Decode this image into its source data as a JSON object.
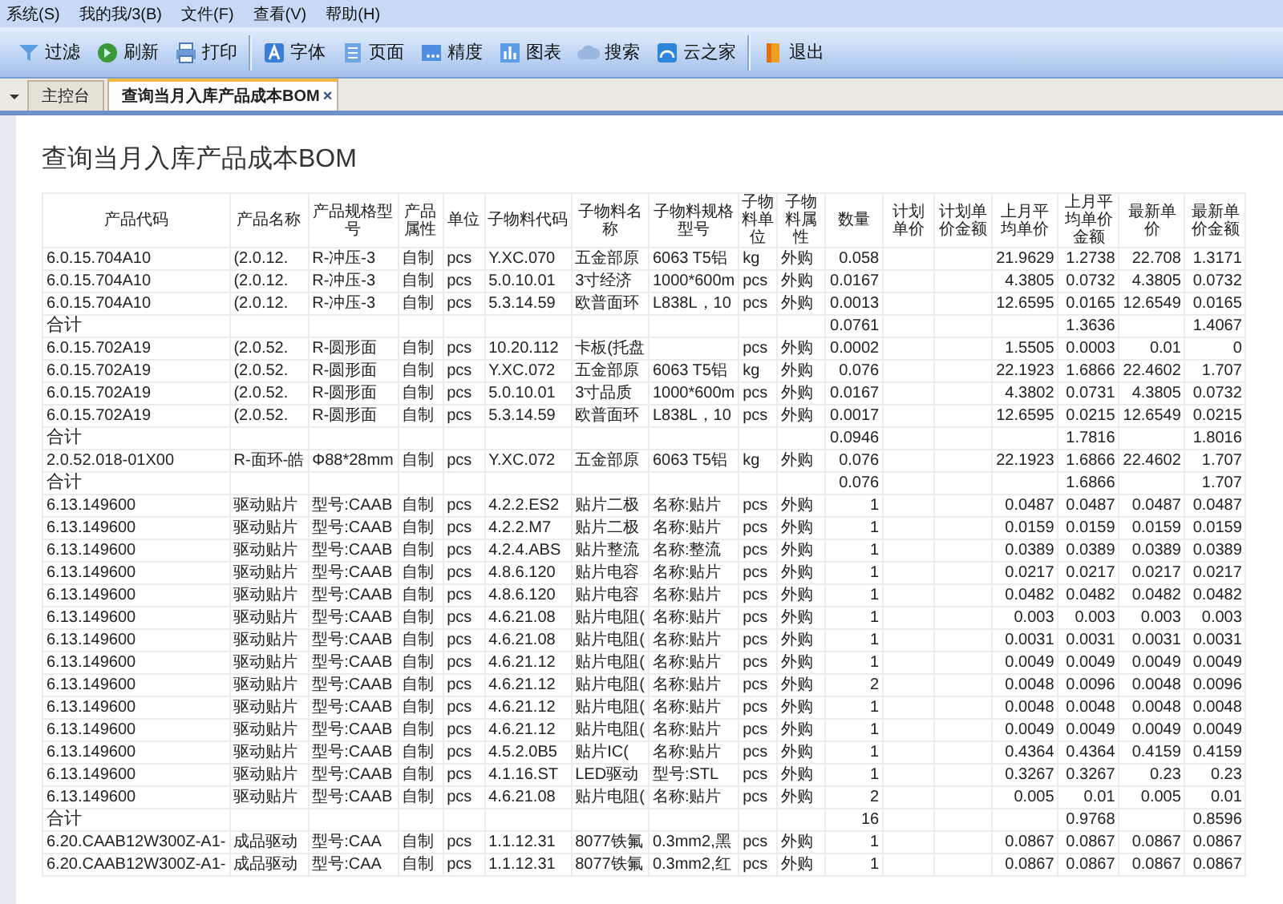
{
  "menu": [
    "系统(S)",
    "我的我/3(B)",
    "文件(F)",
    "查看(V)",
    "帮助(H)"
  ],
  "toolbar": {
    "groups": [
      [
        "过滤",
        "刷新",
        "打印"
      ],
      [
        "字体",
        "页面",
        "精度",
        "图表",
        "搜索",
        "云之家"
      ],
      [
        "退出"
      ]
    ]
  },
  "tabs": [
    {
      "label": "主控台",
      "selected": false
    },
    {
      "label": "查询当月入库产品成本BOM",
      "selected": true,
      "close": "×"
    }
  ],
  "report": {
    "title": "查询当月入库产品成本BOM",
    "table": {
      "columns": [
        "产品代码",
        "产品名称",
        "产品规格型号",
        "产品属性",
        "单位",
        "子物料代码",
        "子物料名称",
        "子物料规格型号",
        "子物料单位",
        "子物料属性",
        "数量",
        "计划单价",
        "计划单价金额",
        "上月平均单价",
        "上月平均单价金额",
        "最新单价",
        "最新单价金额"
      ],
      "rows": [
        {
          "kind": "item",
          "cells": [
            "6.0.15.704A10",
            "(2.0.12.",
            "R-冲压-3",
            "自制",
            "pcs",
            "Y.XC.070",
            "五金部原",
            "6063 T5铝",
            "kg",
            "外购",
            "0.058",
            null,
            null,
            "21.9629",
            "1.2738",
            "22.708",
            "1.3171"
          ]
        },
        {
          "kind": "item",
          "cells": [
            "6.0.15.704A10",
            "(2.0.12.",
            "R-冲压-3",
            "自制",
            "pcs",
            "5.0.10.01",
            "3寸经济",
            "1000*600m",
            "pcs",
            "外购",
            "0.0167",
            null,
            null,
            "4.3805",
            "0.0732",
            "4.3805",
            "0.0732"
          ]
        },
        {
          "kind": "item",
          "cells": [
            "6.0.15.704A10",
            "(2.0.12.",
            "R-冲压-3",
            "自制",
            "pcs",
            "5.3.14.59",
            "欧普面环",
            "L838L，10",
            "pcs",
            "外购",
            "0.0013",
            null,
            null,
            "12.6595",
            "0.0165",
            "12.6549",
            "0.0165"
          ]
        },
        {
          "kind": "total",
          "cells": [
            "合计",
            null,
            null,
            null,
            null,
            null,
            null,
            null,
            null,
            null,
            "0.0761",
            null,
            null,
            null,
            "1.3636",
            null,
            "1.4067"
          ]
        },
        {
          "kind": "item",
          "cells": [
            "6.0.15.702A19",
            "(2.0.52.",
            "R-圆形面",
            "自制",
            "pcs",
            "10.20.112",
            "卡板(托盘",
            null,
            "pcs",
            "外购",
            "0.0002",
            null,
            null,
            "1.5505",
            "0.0003",
            "0.01",
            "0"
          ]
        },
        {
          "kind": "item",
          "cells": [
            "6.0.15.702A19",
            "(2.0.52.",
            "R-圆形面",
            "自制",
            "pcs",
            "Y.XC.072",
            "五金部原",
            "6063 T5铝",
            "kg",
            "外购",
            "0.076",
            null,
            null,
            "22.1923",
            "1.6866",
            "22.4602",
            "1.707"
          ]
        },
        {
          "kind": "item",
          "cells": [
            "6.0.15.702A19",
            "(2.0.52.",
            "R-圆形面",
            "自制",
            "pcs",
            "5.0.10.01",
            "3寸品质",
            "1000*600m",
            "pcs",
            "外购",
            "0.0167",
            null,
            null,
            "4.3802",
            "0.0731",
            "4.3805",
            "0.0732"
          ]
        },
        {
          "kind": "item",
          "cells": [
            "6.0.15.702A19",
            "(2.0.52.",
            "R-圆形面",
            "自制",
            "pcs",
            "5.3.14.59",
            "欧普面环",
            "L838L，10",
            "pcs",
            "外购",
            "0.0017",
            null,
            null,
            "12.6595",
            "0.0215",
            "12.6549",
            "0.0215"
          ]
        },
        {
          "kind": "total",
          "cells": [
            "合计",
            null,
            null,
            null,
            null,
            null,
            null,
            null,
            null,
            null,
            "0.0946",
            null,
            null,
            null,
            "1.7816",
            null,
            "1.8016"
          ]
        },
        {
          "kind": "item",
          "cells": [
            "2.0.52.018-01X00",
            "R-面环-皓",
            "Φ88*28mm",
            "自制",
            "pcs",
            "Y.XC.072",
            "五金部原",
            "6063 T5铝",
            "kg",
            "外购",
            "0.076",
            null,
            null,
            "22.1923",
            "1.6866",
            "22.4602",
            "1.707"
          ]
        },
        {
          "kind": "total",
          "cells": [
            "合计",
            null,
            null,
            null,
            null,
            null,
            null,
            null,
            null,
            null,
            "0.076",
            null,
            null,
            null,
            "1.6866",
            null,
            "1.707"
          ]
        },
        {
          "kind": "item",
          "cells": [
            "6.13.149600",
            "驱动贴片",
            "型号:CAAB",
            "自制",
            "pcs",
            "4.2.2.ES2",
            "贴片二极",
            "名称:贴片",
            "pcs",
            "外购",
            "1",
            null,
            null,
            "0.0487",
            "0.0487",
            "0.0487",
            "0.0487"
          ]
        },
        {
          "kind": "item",
          "cells": [
            "6.13.149600",
            "驱动贴片",
            "型号:CAAB",
            "自制",
            "pcs",
            "4.2.2.M7",
            "贴片二极",
            "名称:贴片",
            "pcs",
            "外购",
            "1",
            null,
            null,
            "0.0159",
            "0.0159",
            "0.0159",
            "0.0159"
          ]
        },
        {
          "kind": "item",
          "cells": [
            "6.13.149600",
            "驱动贴片",
            "型号:CAAB",
            "自制",
            "pcs",
            "4.2.4.ABS",
            "贴片整流",
            "名称:整流",
            "pcs",
            "外购",
            "1",
            null,
            null,
            "0.0389",
            "0.0389",
            "0.0389",
            "0.0389"
          ]
        },
        {
          "kind": "item",
          "cells": [
            "6.13.149600",
            "驱动贴片",
            "型号:CAAB",
            "自制",
            "pcs",
            "4.8.6.120",
            "贴片电容",
            "名称:贴片",
            "pcs",
            "外购",
            "1",
            null,
            null,
            "0.0217",
            "0.0217",
            "0.0217",
            "0.0217"
          ]
        },
        {
          "kind": "item",
          "cells": [
            "6.13.149600",
            "驱动贴片",
            "型号:CAAB",
            "自制",
            "pcs",
            "4.8.6.120",
            "贴片电容",
            "名称:贴片",
            "pcs",
            "外购",
            "1",
            null,
            null,
            "0.0482",
            "0.0482",
            "0.0482",
            "0.0482"
          ]
        },
        {
          "kind": "item",
          "cells": [
            "6.13.149600",
            "驱动贴片",
            "型号:CAAB",
            "自制",
            "pcs",
            "4.6.21.08",
            "贴片电阻(",
            "名称:贴片",
            "pcs",
            "外购",
            "1",
            null,
            null,
            "0.003",
            "0.003",
            "0.003",
            "0.003"
          ]
        },
        {
          "kind": "item",
          "cells": [
            "6.13.149600",
            "驱动贴片",
            "型号:CAAB",
            "自制",
            "pcs",
            "4.6.21.08",
            "贴片电阻(",
            "名称:贴片",
            "pcs",
            "外购",
            "1",
            null,
            null,
            "0.0031",
            "0.0031",
            "0.0031",
            "0.0031"
          ]
        },
        {
          "kind": "item",
          "cells": [
            "6.13.149600",
            "驱动贴片",
            "型号:CAAB",
            "自制",
            "pcs",
            "4.6.21.12",
            "贴片电阻(",
            "名称:贴片",
            "pcs",
            "外购",
            "1",
            null,
            null,
            "0.0049",
            "0.0049",
            "0.0049",
            "0.0049"
          ]
        },
        {
          "kind": "item",
          "cells": [
            "6.13.149600",
            "驱动贴片",
            "型号:CAAB",
            "自制",
            "pcs",
            "4.6.21.12",
            "贴片电阻(",
            "名称:贴片",
            "pcs",
            "外购",
            "2",
            null,
            null,
            "0.0048",
            "0.0096",
            "0.0048",
            "0.0096"
          ]
        },
        {
          "kind": "item",
          "cells": [
            "6.13.149600",
            "驱动贴片",
            "型号:CAAB",
            "自制",
            "pcs",
            "4.6.21.12",
            "贴片电阻(",
            "名称:贴片",
            "pcs",
            "外购",
            "1",
            null,
            null,
            "0.0048",
            "0.0048",
            "0.0048",
            "0.0048"
          ]
        },
        {
          "kind": "item",
          "cells": [
            "6.13.149600",
            "驱动贴片",
            "型号:CAAB",
            "自制",
            "pcs",
            "4.6.21.12",
            "贴片电阻(",
            "名称:贴片",
            "pcs",
            "外购",
            "1",
            null,
            null,
            "0.0049",
            "0.0049",
            "0.0049",
            "0.0049"
          ]
        },
        {
          "kind": "item",
          "cells": [
            "6.13.149600",
            "驱动贴片",
            "型号:CAAB",
            "自制",
            "pcs",
            "4.5.2.0B5",
            "贴片IC(",
            "名称:贴片",
            "pcs",
            "外购",
            "1",
            null,
            null,
            "0.4364",
            "0.4364",
            "0.4159",
            "0.4159"
          ]
        },
        {
          "kind": "item",
          "cells": [
            "6.13.149600",
            "驱动贴片",
            "型号:CAAB",
            "自制",
            "pcs",
            "4.1.16.ST",
            "LED驱动",
            "型号:STL",
            "pcs",
            "外购",
            "1",
            null,
            null,
            "0.3267",
            "0.3267",
            "0.23",
            "0.23"
          ]
        },
        {
          "kind": "item",
          "cells": [
            "6.13.149600",
            "驱动贴片",
            "型号:CAAB",
            "自制",
            "pcs",
            "4.6.21.08",
            "贴片电阻(",
            "名称:贴片",
            "pcs",
            "外购",
            "2",
            null,
            null,
            "0.005",
            "0.01",
            "0.005",
            "0.01"
          ]
        },
        {
          "kind": "total",
          "cells": [
            "合计",
            null,
            null,
            null,
            null,
            null,
            null,
            null,
            null,
            null,
            "16",
            null,
            null,
            null,
            "0.9768",
            null,
            "0.8596"
          ]
        },
        {
          "kind": "item",
          "cells": [
            "6.20.CAAB12W300Z-A1-",
            "成品驱动",
            "型号:CAA",
            "自制",
            "pcs",
            "1.1.12.31",
            "8077铁氟",
            "0.3mm2,黑",
            "pcs",
            "外购",
            "1",
            null,
            null,
            "0.0867",
            "0.0867",
            "0.0867",
            "0.0867"
          ]
        },
        {
          "kind": "item",
          "cells": [
            "6.20.CAAB12W300Z-A1-",
            "成品驱动",
            "型号:CAA",
            "自制",
            "pcs",
            "1.1.12.31",
            "8077铁氟",
            "0.3mm2,红",
            "pcs",
            "外购",
            "1",
            null,
            null,
            "0.0867",
            "0.0867",
            "0.0867",
            "0.0867"
          ]
        }
      ]
    }
  }
}
